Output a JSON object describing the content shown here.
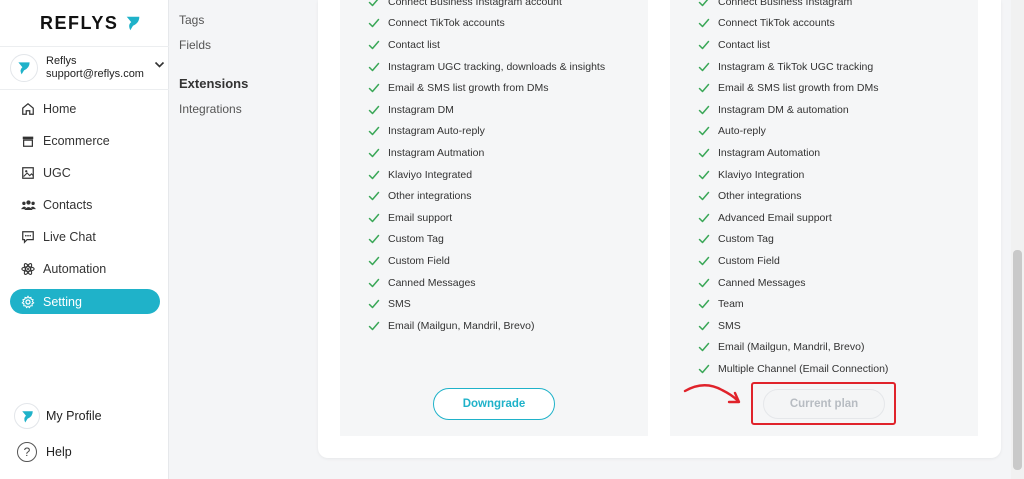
{
  "brand": {
    "name": "REFLYS",
    "accent": "#1fb2c9"
  },
  "account": {
    "name": "Reflys",
    "email": "support@reflys.com"
  },
  "nav": [
    {
      "label": "Home",
      "icon": "home-icon"
    },
    {
      "label": "Ecommerce",
      "icon": "store-icon"
    },
    {
      "label": "UGC",
      "icon": "image-icon"
    },
    {
      "label": "Contacts",
      "icon": "users-icon"
    },
    {
      "label": "Live Chat",
      "icon": "chat-icon"
    },
    {
      "label": "Automation",
      "icon": "atom-icon"
    },
    {
      "label": "Setting",
      "icon": "gear-icon",
      "active": true
    }
  ],
  "bottom": {
    "profile_label": "My Profile",
    "help_label": "Help"
  },
  "settings_menu": {
    "tags": "Tags",
    "fields": "Fields",
    "extensions_heading": "Extensions",
    "integrations": "Integrations"
  },
  "plans": [
    {
      "features": [
        "Connect Business Instagram account",
        "Connect TikTok accounts",
        "Contact list",
        "Instagram UGC tracking, downloads & insights",
        "Email & SMS list growth from DMs",
        "Instagram DM",
        "Instagram Auto-reply",
        "Instagram Autmation",
        "Klaviyo Integrated",
        "Other integrations",
        "Email support",
        "Custom Tag",
        "Custom Field",
        "Canned Messages",
        "SMS",
        "Email (Mailgun, Mandril, Brevo)"
      ],
      "button_label": "Downgrade"
    },
    {
      "features": [
        "Connect Business Instagram",
        "Connect TikTok accounts",
        "Contact list",
        "Instagram & TikTok UGC tracking",
        "Email & SMS list growth from DMs",
        "Instagram DM & automation",
        "Auto-reply",
        "Instagram Automation",
        "Klaviyo Integration",
        "Other integrations",
        "Advanced Email support",
        "Custom Tag",
        "Custom Field",
        "Canned Messages",
        "Team",
        "SMS",
        "Email (Mailgun, Mandril, Brevo)",
        "Multiple Channel (Email Connection)"
      ],
      "button_label": "Current plan"
    }
  ],
  "colors": {
    "check": "#3aa757",
    "highlight": "#e0232b",
    "active_nav": "#1fb2c9"
  }
}
